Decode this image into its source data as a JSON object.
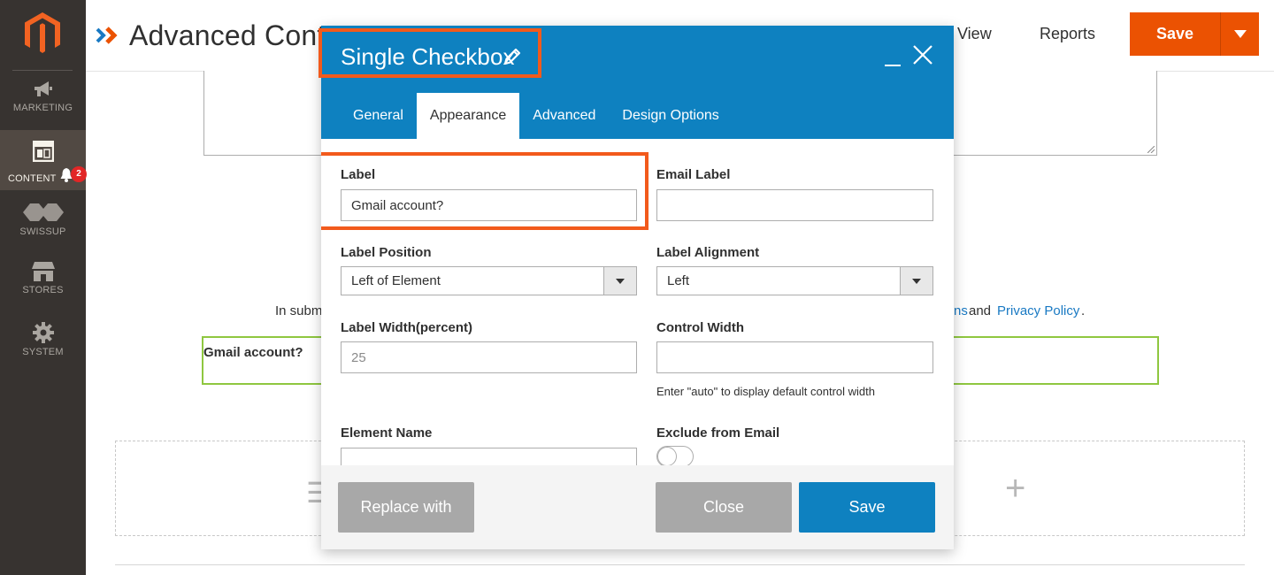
{
  "sidebar": {
    "items": [
      {
        "label": "MARKETING",
        "icon": "megaphone-icon"
      },
      {
        "label": "CONTENT",
        "icon": "layout-icon"
      },
      {
        "label": "SWISSUP",
        "icon": "swissup-icon"
      },
      {
        "label": "STORES",
        "icon": "store-icon"
      },
      {
        "label": "SYSTEM",
        "icon": "gear-icon"
      }
    ],
    "notification_count": "2"
  },
  "header": {
    "title": "Advanced Cont",
    "view_label": "View",
    "reports_label": "Reports",
    "save_label": "Save"
  },
  "background": {
    "terms_prefix": "In subm",
    "terms_suffix_link": "ns",
    "terms_and": "and",
    "privacy_link": "Privacy Policy",
    "terms_period": ".",
    "gmail_label": "Gmail account?"
  },
  "modal": {
    "title": "Single Checkbox",
    "tabs": [
      {
        "label": "General"
      },
      {
        "label": "Appearance"
      },
      {
        "label": "Advanced"
      },
      {
        "label": "Design Options"
      }
    ],
    "fields": {
      "label": {
        "label": "Label",
        "value": "Gmail account?"
      },
      "email_label": {
        "label": "Email Label",
        "value": ""
      },
      "label_position": {
        "label": "Label Position",
        "value": "Left of Element"
      },
      "label_alignment": {
        "label": "Label Alignment",
        "value": "Left"
      },
      "label_width": {
        "label": "Label Width(percent)",
        "value": "25"
      },
      "control_width": {
        "label": "Control Width",
        "value": "",
        "hint": "Enter \"auto\" to display default control width"
      },
      "element_name": {
        "label": "Element Name",
        "value": ""
      },
      "exclude_email": {
        "label": "Exclude from Email",
        "checked": false
      }
    },
    "footer": {
      "replace_label": "Replace with",
      "close_label": "Close",
      "save_label": "Save"
    }
  },
  "colors": {
    "brand_orange": "#eb5202",
    "modal_blue": "#0e81c0",
    "highlight": "#f25a1c",
    "sidebar_bg": "#373330"
  }
}
